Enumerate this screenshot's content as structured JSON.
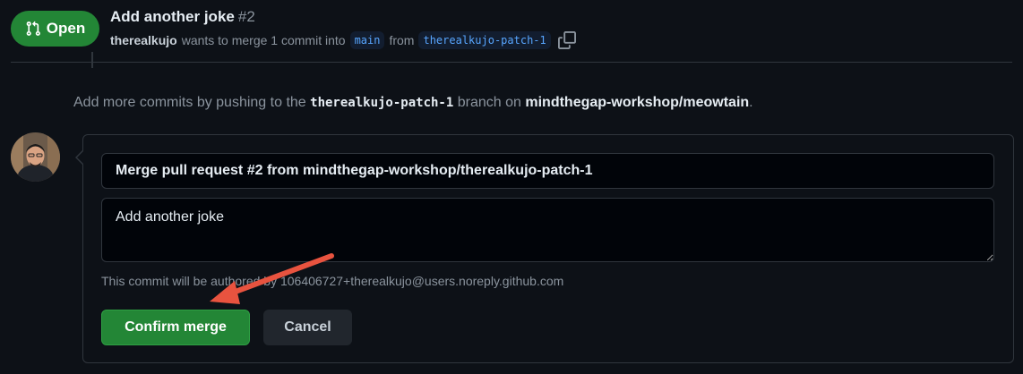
{
  "header": {
    "status_badge": "Open",
    "status_icon": "git-pull-request-icon",
    "title": "Add another joke",
    "number": "#2",
    "author": "therealkujo",
    "merge_text_1": "wants to merge 1 commit into",
    "base_branch": "main",
    "merge_text_2": "from",
    "head_branch": "therealkujo-patch-1",
    "copy_icon": "copy-icon"
  },
  "info": {
    "prefix": "Add more commits by pushing to the",
    "branch": "therealkujo-patch-1",
    "middle": "branch on",
    "repo": "mindthegap-workshop/meowtain",
    "suffix": "."
  },
  "merge_form": {
    "title_value": "Merge pull request #2 from mindthegap-workshop/therealkujo-patch-1",
    "body_value": "Add another joke",
    "author_note": "This commit will be authored by 106406727+therealkujo@users.noreply.github.com",
    "confirm_label": "Confirm merge",
    "cancel_label": "Cancel"
  },
  "colors": {
    "background": "#0d1117",
    "accent_green": "#238636",
    "link_blue": "#58a6ff",
    "arrow_red": "#e8533f"
  }
}
